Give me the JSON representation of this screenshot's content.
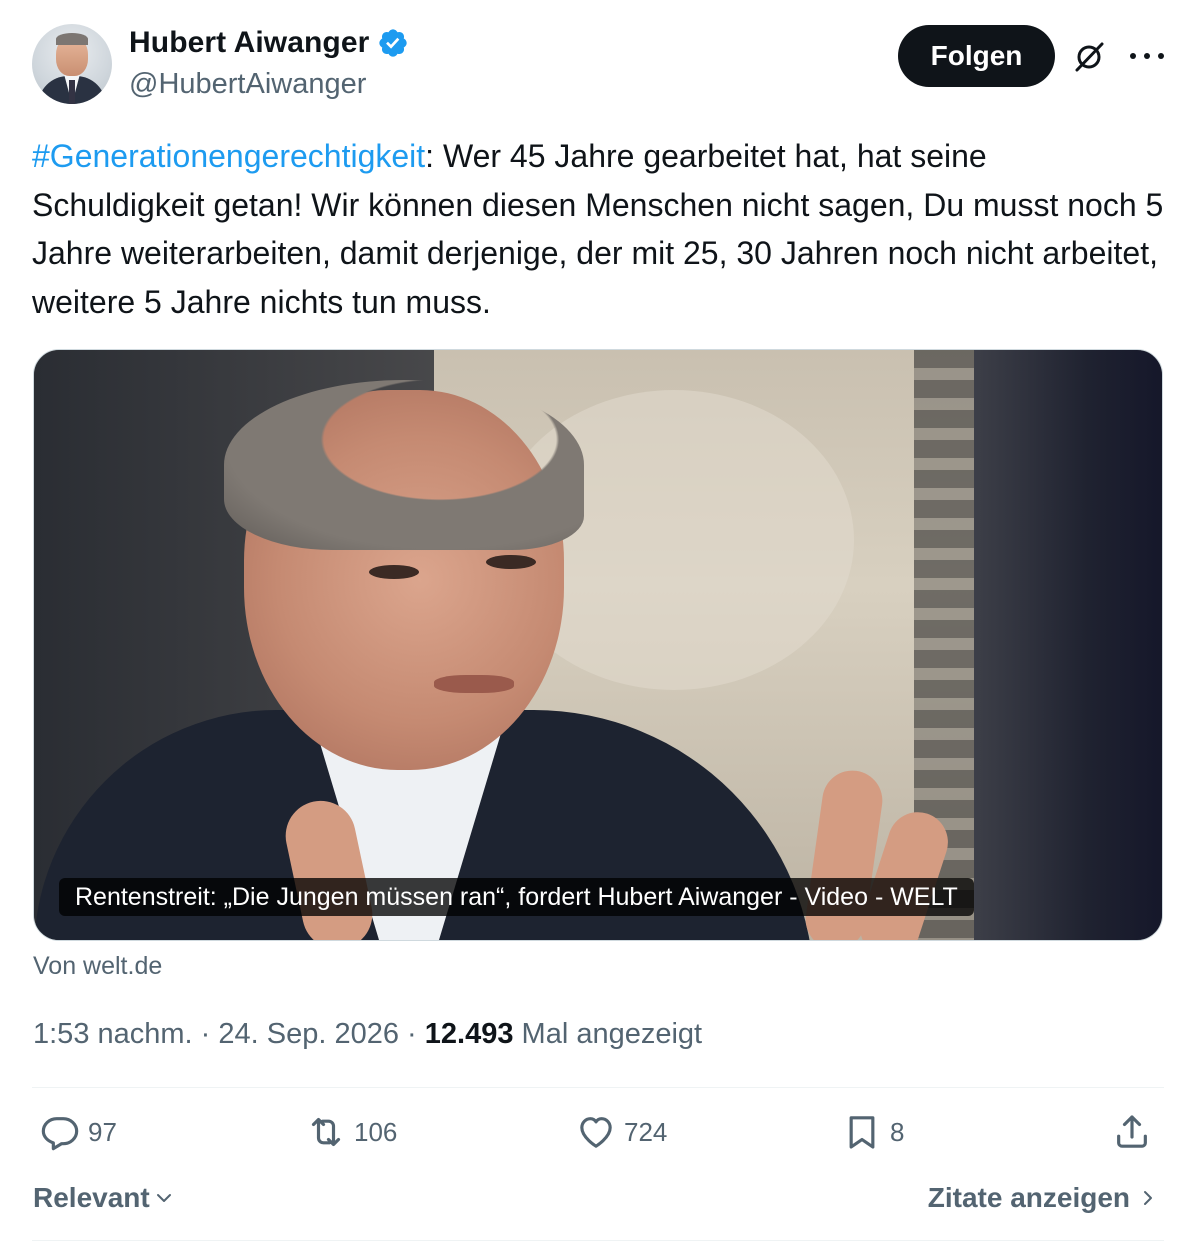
{
  "author": {
    "display_name": "Hubert Aiwanger",
    "handle": "@HubertAiwanger",
    "verified": true
  },
  "header": {
    "follow_label": "Folgen",
    "grok_icon": "grok-icon",
    "more_icon": "more-icon"
  },
  "tweet": {
    "hashtag": "#Generationengerechtigkeit",
    "text": ": Wer 45 Jahre gearbeitet hat, hat seine Schuldigkeit getan! Wir können diesen Menschen nicht sagen, Du musst noch 5 Jahre weiterarbeiten, damit derjenige, der mit 25, 30 Jahren noch nicht arbeitet, weitere 5 Jahre nichts tun muss."
  },
  "media": {
    "caption": "Rentenstreit: „Die Jungen müssen ran“, fordert Hubert Aiwanger - Video - WELT",
    "source": "Von welt.de"
  },
  "meta": {
    "time": "1:53 nachm.",
    "separator": " · ",
    "date": "24. Sep. 2026",
    "views_count": "12.493",
    "views_label": " Mal angezeigt"
  },
  "actions": {
    "replies": "97",
    "reposts": "106",
    "likes": "724",
    "bookmarks": "8"
  },
  "footer": {
    "sort_label": "Relevant",
    "quotes_label": "Zitate anzeigen"
  },
  "colors": {
    "accent": "#1d9bf0",
    "text": "#0f1419",
    "secondary": "#536471"
  }
}
